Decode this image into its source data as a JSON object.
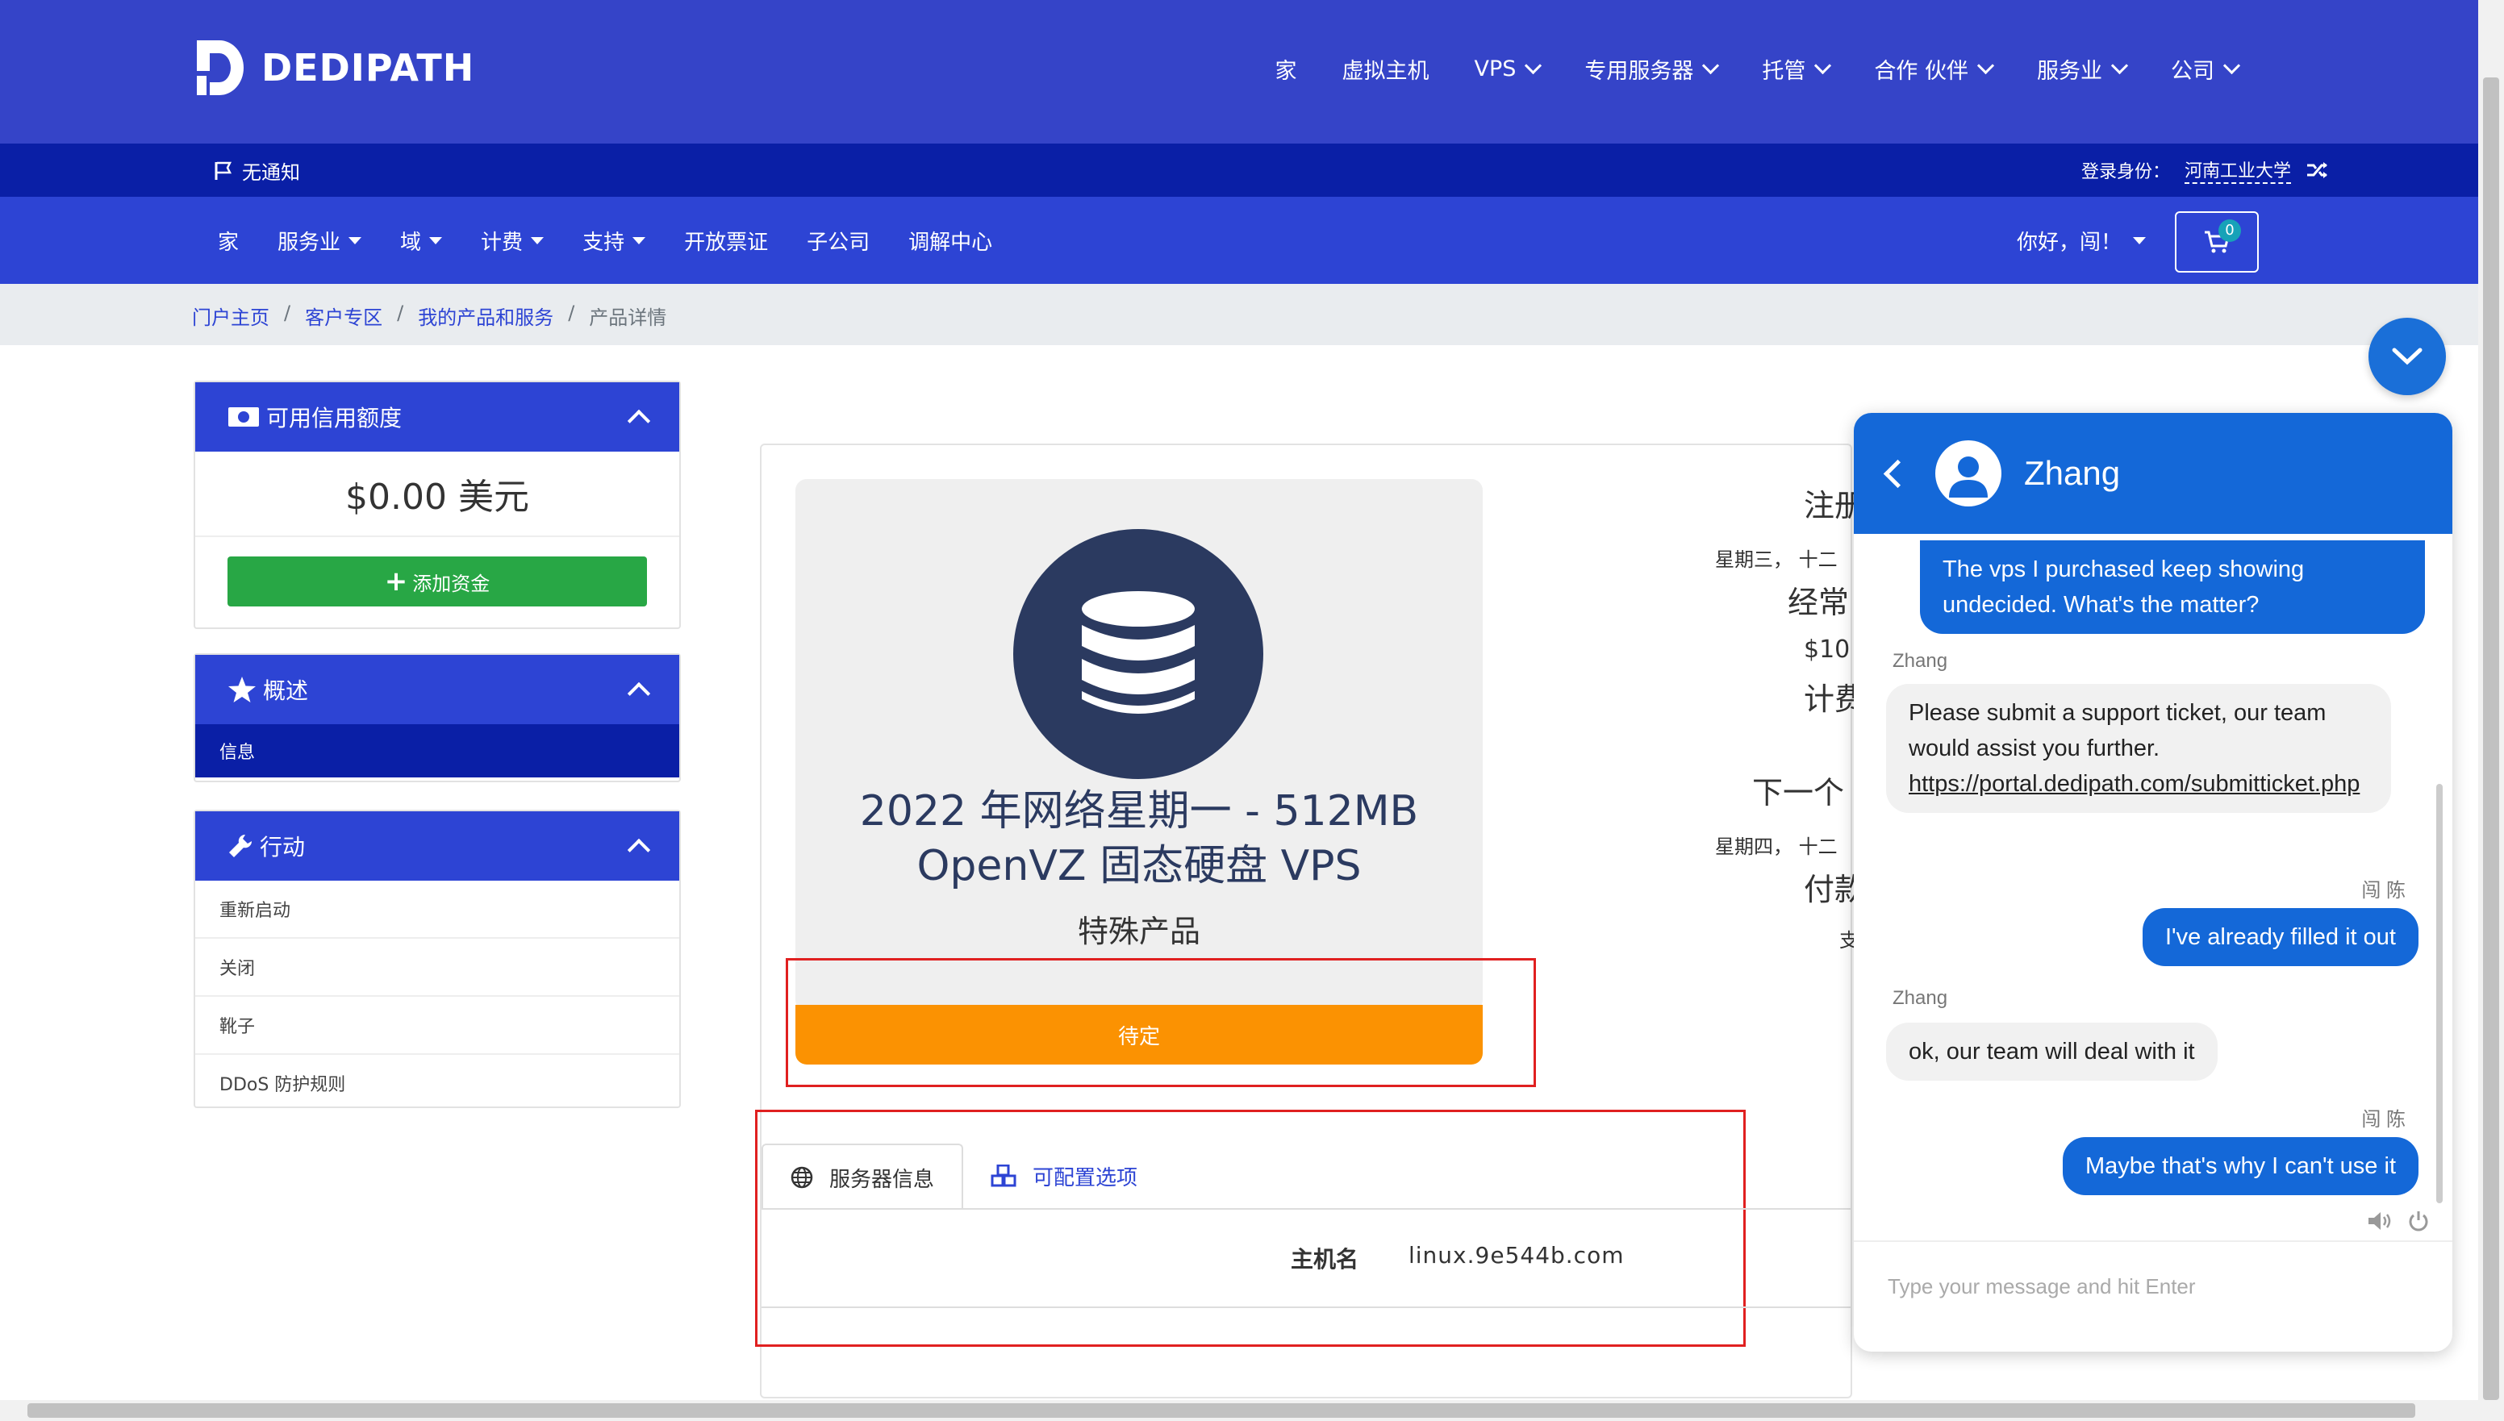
{
  "brand": {
    "name": "DEDIPATH",
    "color": "#3544c8"
  },
  "topnav": [
    {
      "label": "家",
      "dropdown": false
    },
    {
      "label": "虚拟主机",
      "dropdown": false
    },
    {
      "label": "VPS",
      "dropdown": true
    },
    {
      "label": "专用服务器",
      "dropdown": true
    },
    {
      "label": "托管",
      "dropdown": true
    },
    {
      "label": "合作 伙伴",
      "dropdown": true
    },
    {
      "label": "服务业",
      "dropdown": true
    },
    {
      "label": "公司",
      "dropdown": true
    }
  ],
  "notification": {
    "label": "无通知",
    "icon": "flag-icon"
  },
  "login": {
    "prefix": "登录身份：",
    "user": "河南工业大学",
    "icon": "shuffle-icon"
  },
  "subnav": [
    {
      "label": "家",
      "dropdown": false
    },
    {
      "label": "服务业",
      "dropdown": true
    },
    {
      "label": "域",
      "dropdown": true
    },
    {
      "label": "计费",
      "dropdown": true
    },
    {
      "label": "支持",
      "dropdown": true
    },
    {
      "label": "开放票证",
      "dropdown": false
    },
    {
      "label": "子公司",
      "dropdown": false
    },
    {
      "label": "调解中心",
      "dropdown": false
    }
  ],
  "greeting": "你好，闯！",
  "cart": {
    "count": "0",
    "icon": "cart-icon"
  },
  "breadcrumb": [
    "门户主页",
    "客户专区",
    "我的产品和服务",
    "产品详情"
  ],
  "credit_panel": {
    "title": "可用信用额度",
    "amount": "$0.00 美元",
    "button": "添加资金"
  },
  "overview_panel": {
    "title": "概述",
    "items": [
      "信息"
    ]
  },
  "actions_panel": {
    "title": "行动",
    "items": [
      "重新启动",
      "关闭",
      "靴子",
      "DDoS 防护规则"
    ]
  },
  "product": {
    "title_line1": "2022 年网络星期一 - 512MB",
    "title_line2": "OpenVZ 固态硬盘 VPS",
    "subtitle": "特殊产品",
    "status": "待定",
    "status_color": "#fb9202"
  },
  "details_partial": {
    "reg_label": "注册",
    "reg_date": "星期三， 十二",
    "recurring_label": "经常",
    "recurring_amount": "$10",
    "billing_label": "计费",
    "next_due_label": "下一个",
    "next_due_date": "星期四， 十二",
    "payment_label": "付款",
    "payment_value": "支"
  },
  "tabs": [
    {
      "label": "服务器信息",
      "icon": "globe-icon",
      "active": true
    },
    {
      "label": "可配置选项",
      "icon": "cubes-icon",
      "active": false
    }
  ],
  "server_info": {
    "hostname_label": "主机名",
    "hostname_value": "linux.9e544b.com"
  },
  "chat": {
    "agent_name": "Zhang",
    "messages": [
      {
        "from": "me",
        "text": "The vps I purchased keep showing undecided. What's the matter?"
      },
      {
        "from": "Zhang",
        "text": "Please submit a support ticket, our team would assist you further.",
        "link": "https://portal.dedipath.com/submitticket.php"
      },
      {
        "from": "闯 陈",
        "text": "I've already filled it out"
      },
      {
        "from": "Zhang",
        "text": "ok, our team will deal with it"
      },
      {
        "from": "闯 陈",
        "text": "Maybe that's why I can't use it"
      }
    ],
    "input_placeholder": "Type your message and hit Enter"
  }
}
